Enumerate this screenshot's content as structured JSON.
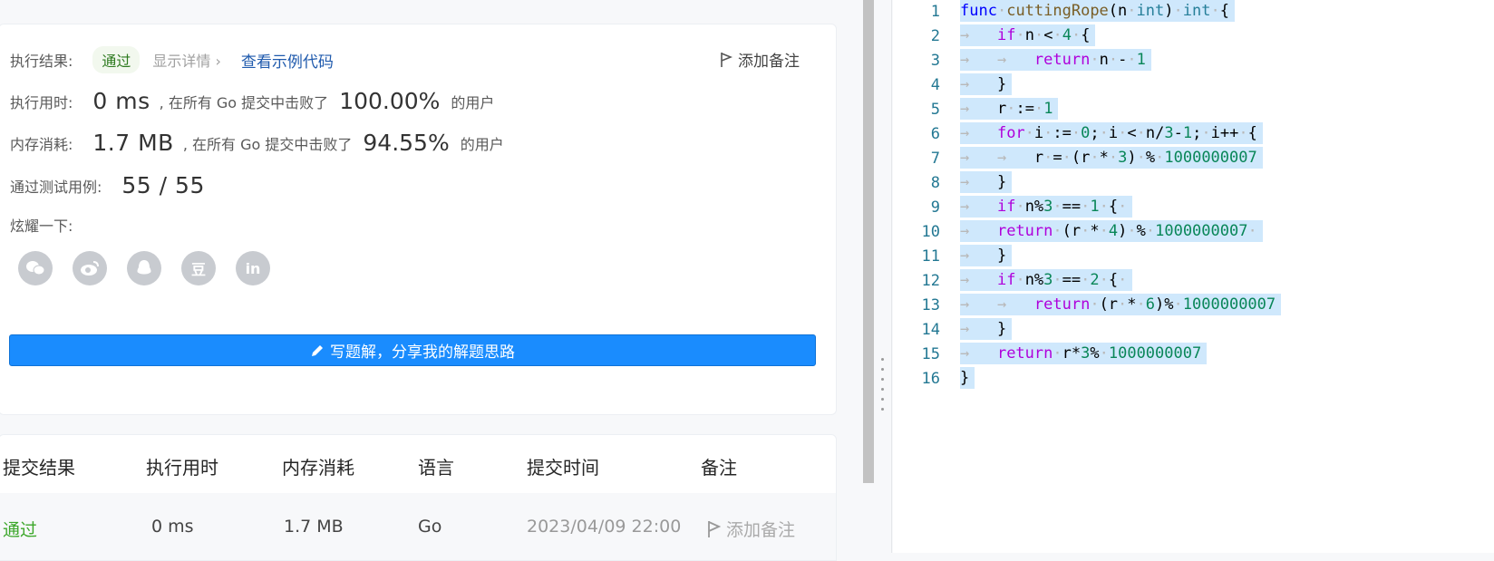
{
  "result": {
    "label": "执行结果:",
    "status": "通过",
    "details_link": "显示详情 ›",
    "example_link": "查看示例代码",
    "add_note": "添加备注"
  },
  "runtime": {
    "label": "执行用时:",
    "value": "0 ms",
    "mid_text": ", 在所有 Go 提交中击败了",
    "percent": "100.00%",
    "suffix": "的用户"
  },
  "memory": {
    "label": "内存消耗:",
    "value": "1.7 MB",
    "mid_text": ", 在所有 Go 提交中击败了",
    "percent": "94.55%",
    "suffix": "的用户"
  },
  "tests": {
    "label": "通过测试用例:",
    "value": "55 / 55"
  },
  "share": {
    "label": "炫耀一下:",
    "icons": [
      "wechat-icon",
      "weibo-icon",
      "qq-icon",
      "douban-icon",
      "linkedin-icon"
    ],
    "douban_glyph": "豆",
    "linkedin_glyph": "in"
  },
  "write_solution_button": "写题解，分享我的解题思路",
  "submissions": {
    "headers": [
      "提交结果",
      "执行用时",
      "内存消耗",
      "语言",
      "提交时间",
      "备注"
    ],
    "rows": [
      {
        "result": "通过",
        "runtime": "0 ms",
        "memory": "1.7 MB",
        "language": "Go",
        "time": "2023/04/09 22:00",
        "note": "添加备注"
      }
    ]
  },
  "colors": {
    "accent": "#1a8cfe",
    "pass_green": "#3ca72a",
    "link_blue": "#1f5aad",
    "selection": "#cfe8fc"
  },
  "editor": {
    "line_numbers": [
      "1",
      "2",
      "3",
      "4",
      "5",
      "6",
      "7",
      "8",
      "9",
      "10",
      "11",
      "12",
      "13",
      "14",
      "15",
      "16"
    ],
    "lines": [
      "func cuttingRope(n int) int {",
      "    if n < 4 {",
      "        return n - 1",
      "    }",
      "    r := 1",
      "    for i := 0; i < n/3-1; i++ {",
      "        r = (r * 3) % 1000000007",
      "    }",
      "    if n%3 == 1 {",
      "    return (r * 4) % 1000000007",
      "    }",
      "    if n%3 == 2 {",
      "        return (r * 6)% 1000000007",
      "    }",
      "    return r*3% 1000000007",
      "}"
    ]
  }
}
